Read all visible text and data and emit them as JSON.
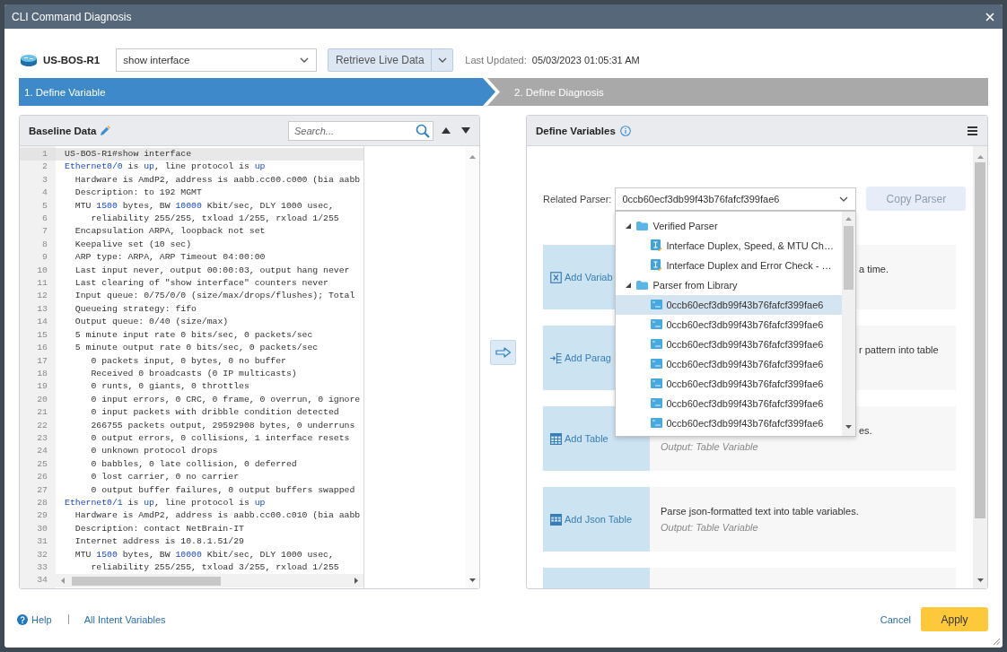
{
  "window": {
    "title": "CLI Command Diagnosis"
  },
  "toolbar": {
    "device": "US-BOS-R1",
    "command": "show interface",
    "retrieve_button": "Retrieve Live Data",
    "last_updated_label": "Last Updated:",
    "last_updated": "05/03/2023 01:05:31 AM"
  },
  "steps": [
    {
      "label": "1. Define Variable",
      "selected": true
    },
    {
      "label": "2. Define Diagnosis",
      "selected": false
    }
  ],
  "baseline": {
    "title": "Baseline Data",
    "search": {
      "placeholder": "Search..."
    },
    "lines": [
      {
        "number": "1",
        "current": true,
        "text": "US-BOS-R1#show interface"
      },
      {
        "number": "2",
        "current": false,
        "parts": [
          {
            "text": "Ethernet0/0",
            "kind": "keyword"
          },
          {
            "text": " is ",
            "kind": "plain"
          },
          {
            "text": "up",
            "kind": "keyword"
          },
          {
            "text": ", line protocol is ",
            "kind": "plain"
          },
          {
            "text": "up",
            "kind": "keyword"
          }
        ]
      },
      {
        "number": "3",
        "current": false,
        "text": "  Hardware is AmdP2, address is aabb.cc00.c000 (bia aabb"
      },
      {
        "number": "4",
        "current": false,
        "text": "  Description: to 192 MGMT"
      },
      {
        "number": "5",
        "current": false,
        "parts": [
          {
            "text": "  MTU ",
            "kind": "plain"
          },
          {
            "text": "1500",
            "kind": "keyword"
          },
          {
            "text": " bytes, BW ",
            "kind": "plain"
          },
          {
            "text": "10000",
            "kind": "keyword"
          },
          {
            "text": " Kbit/sec, DLY 1000 usec,",
            "kind": "plain"
          }
        ]
      },
      {
        "number": "6",
        "current": false,
        "text": "     reliability 255/255, txload 1/255, rxload 1/255"
      },
      {
        "number": "7",
        "current": false,
        "text": "  Encapsulation ARPA, loopback not set"
      },
      {
        "number": "8",
        "current": false,
        "text": "  Keepalive set (10 sec)"
      },
      {
        "number": "9",
        "current": false,
        "text": "  ARP type: ARPA, ARP Timeout 04:00:00"
      },
      {
        "number": "10",
        "current": false,
        "text": "  Last input never, output 00:00:03, output hang never"
      },
      {
        "number": "11",
        "current": false,
        "text": "  Last clearing of \"show interface\" counters never"
      },
      {
        "number": "12",
        "current": false,
        "text": "  Input queue: 0/75/0/0 (size/max/drops/flushes); Total"
      },
      {
        "number": "13",
        "current": false,
        "text": "  Queueing strategy: fifo"
      },
      {
        "number": "14",
        "current": false,
        "text": "  Output queue: 0/40 (size/max)"
      },
      {
        "number": "15",
        "current": false,
        "text": "  5 minute input rate 0 bits/sec, 0 packets/sec"
      },
      {
        "number": "16",
        "current": false,
        "text": "  5 minute output rate 0 bits/sec, 0 packets/sec"
      },
      {
        "number": "17",
        "current": false,
        "text": "     0 packets input, 0 bytes, 0 no buffer"
      },
      {
        "number": "18",
        "current": false,
        "text": "     Received 0 broadcasts (0 IP multicasts)"
      },
      {
        "number": "19",
        "current": false,
        "text": "     0 runts, 0 giants, 0 throttles"
      },
      {
        "number": "20",
        "current": false,
        "text": "     0 input errors, 0 CRC, 0 frame, 0 overrun, 0 ignore"
      },
      {
        "number": "21",
        "current": false,
        "text": "     0 input packets with dribble condition detected"
      },
      {
        "number": "22",
        "current": false,
        "text": "     266755 packets output, 29592908 bytes, 0 underruns"
      },
      {
        "number": "23",
        "current": false,
        "text": "     0 output errors, 0 collisions, 1 interface resets"
      },
      {
        "number": "24",
        "current": false,
        "text": "     0 unknown protocol drops"
      },
      {
        "number": "25",
        "current": false,
        "text": "     0 babbles, 0 late collision, 0 deferred"
      },
      {
        "number": "26",
        "current": false,
        "text": "     0 lost carrier, 0 no carrier"
      },
      {
        "number": "27",
        "current": false,
        "text": "     0 output buffer failures, 0 output buffers swapped"
      },
      {
        "number": "28",
        "current": false,
        "parts": [
          {
            "text": "Ethernet0/1",
            "kind": "keyword"
          },
          {
            "text": " is ",
            "kind": "plain"
          },
          {
            "text": "up",
            "kind": "keyword"
          },
          {
            "text": ", line protocol is ",
            "kind": "plain"
          },
          {
            "text": "up",
            "kind": "keyword"
          }
        ]
      },
      {
        "number": "29",
        "current": false,
        "text": "  Hardware is AmdP2, address is aabb.cc00.c010 (bia aabb"
      },
      {
        "number": "30",
        "current": false,
        "text": "  Description: contact NetBrain-IT"
      },
      {
        "number": "31",
        "current": false,
        "text": "  Internet address is 10.8.1.51/29"
      },
      {
        "number": "32",
        "current": false,
        "parts": [
          {
            "text": "  MTU ",
            "kind": "plain"
          },
          {
            "text": "1500",
            "kind": "keyword"
          },
          {
            "text": " bytes, BW ",
            "kind": "plain"
          },
          {
            "text": "10000",
            "kind": "keyword"
          },
          {
            "text": " Kbit/sec, DLY 1000 usec,",
            "kind": "plain"
          }
        ]
      },
      {
        "number": "33",
        "current": false,
        "text": "     reliability 255/255, txload 3/255, rxload 1/255"
      },
      {
        "number": "34",
        "current": false
      }
    ]
  },
  "variables": {
    "title": "Define Variables",
    "parser": {
      "label": "Related Parser:",
      "value": "0ccb60ecf3db99f43b76fafcf399fae6",
      "dropdown": {
        "open": true,
        "groups": [
          {
            "label": "Verified Parser",
            "expanded": true,
            "children": [
              {
                "label": "Interface Duplex, Speed, & MTU Ch…",
                "kind": "verified",
                "selected": false
              },
              {
                "label": "Interface Duplex and Error Check - …",
                "kind": "verified",
                "selected": false
              }
            ]
          },
          {
            "label": "Parser from Library",
            "expanded": true,
            "children": [
              {
                "label": "0ccb60ecf3db99f43b76fafcf399fae6",
                "kind": "library",
                "selected": true
              },
              {
                "label": "0ccb60ecf3db99f43b76fafcf399fae6",
                "kind": "library",
                "selected": false
              },
              {
                "label": "0ccb60ecf3db99f43b76fafcf399fae6",
                "kind": "library",
                "selected": false
              },
              {
                "label": "0ccb60ecf3db99f43b76fafcf399fae6",
                "kind": "library",
                "selected": false
              },
              {
                "label": "0ccb60ecf3db99f43b76fafcf399fae6",
                "kind": "library",
                "selected": false
              },
              {
                "label": "0ccb60ecf3db99f43b76fafcf399fae6",
                "kind": "library",
                "selected": false
              },
              {
                "label": "0ccb60ecf3db99f43b76fafcf399fae6",
                "kind": "library",
                "selected": false
              }
            ]
          }
        ]
      }
    },
    "copy_button": {
      "label": "Copy Parser",
      "disabled": true
    },
    "cards": [
      {
        "kind": "variable",
        "label": "Add Variab",
        "description": {
          "text": "a time.",
          "covered": true
        }
      },
      {
        "kind": "paragraph",
        "label": "Add Parag",
        "description": {
          "text": "r pattern into table",
          "covered": true
        }
      },
      {
        "kind": "table",
        "label": "Add Table",
        "description": {
          "text": "es.",
          "covered": true
        },
        "output": "Output: Table Variable"
      },
      {
        "kind": "json_table",
        "label": "Add Json Table",
        "description": {
          "text": "Parse json-formatted text into table variables.",
          "covered": false
        },
        "output": "Output: Table Variable"
      },
      {
        "kind": "blank"
      }
    ]
  },
  "footer": {
    "help": "Help",
    "all_variables": "All Intent Variables",
    "cancel": "Cancel",
    "apply": "Apply"
  }
}
